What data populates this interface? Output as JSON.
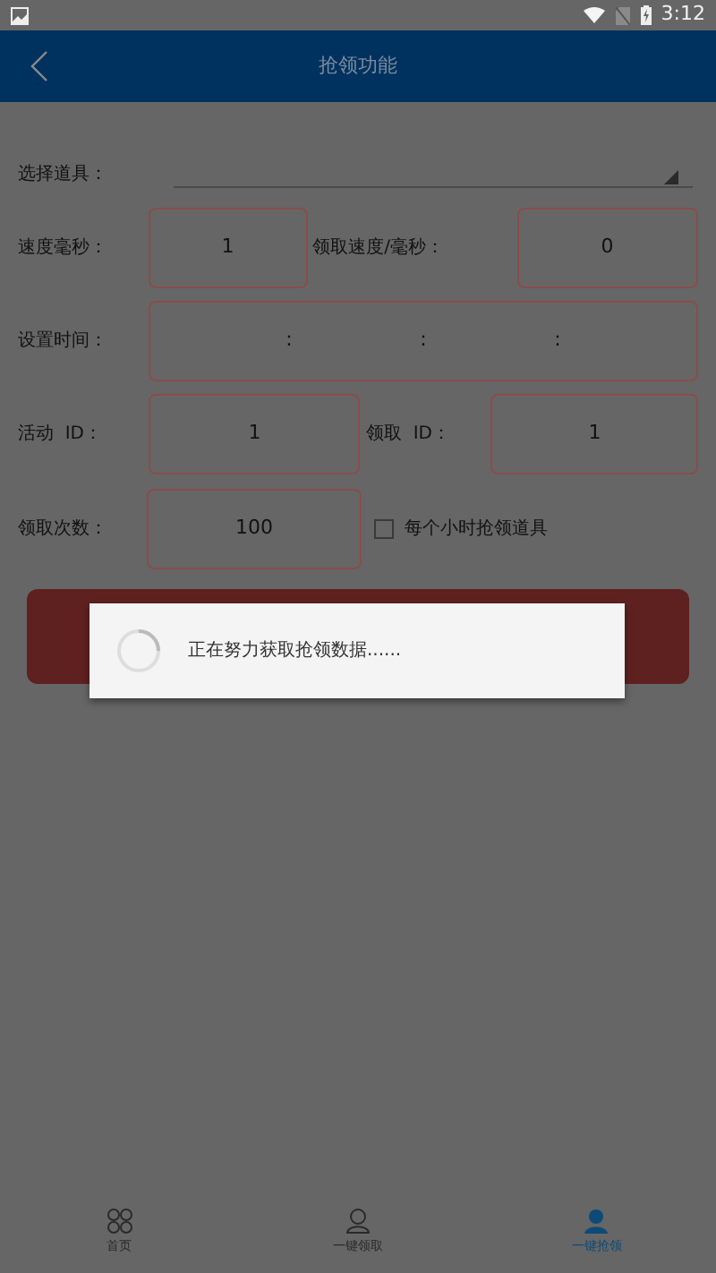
{
  "status_bar": {
    "time": "3:12"
  },
  "header": {
    "title": "抢领功能"
  },
  "form": {
    "prop_select": {
      "label": "选择道具："
    },
    "speed": {
      "label": "速度毫秒：",
      "value": "1"
    },
    "claim_speed": {
      "label": "领取速度/毫秒：",
      "value": "0"
    },
    "set_time": {
      "label": "设置时间：",
      "separators": [
        ":",
        ":",
        ":"
      ]
    },
    "activity_id": {
      "label": "活动  ID：",
      "value": "1"
    },
    "claim_id": {
      "label": "领取  ID：",
      "value": "1"
    },
    "claim_count": {
      "label": "领取次数：",
      "value": "100"
    },
    "hourly": {
      "label": "每个小时抢领道具",
      "checked": false
    }
  },
  "dialog": {
    "message": "正在努力获取抢领数据......"
  },
  "bottom_nav": [
    {
      "label": "首页",
      "kind": "grid",
      "selected": false
    },
    {
      "label": "一键领取",
      "kind": "person",
      "selected": false
    },
    {
      "label": "一键抢领",
      "kind": "person",
      "selected": true
    }
  ]
}
